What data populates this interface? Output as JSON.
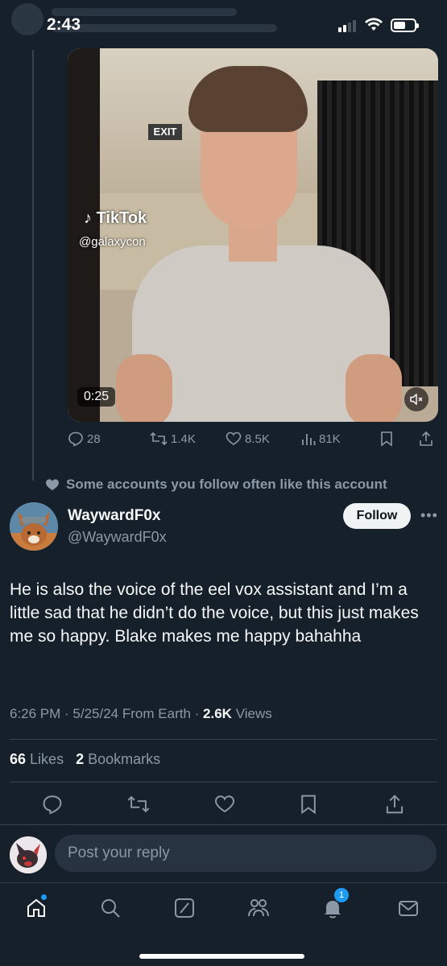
{
  "status_bar": {
    "time": "2:43"
  },
  "video": {
    "exit_sign": "EXIT",
    "tiktok_logo": "TikTok",
    "tiktok_handle": "@galaxycon",
    "duration": "0:25"
  },
  "quoted_stats": {
    "replies": "28",
    "reposts": "1.4K",
    "likes": "8.5K",
    "views": "81K"
  },
  "social_context": "Some accounts you follow often like this account",
  "author": {
    "display_name": "WaywardF0x",
    "handle": "@WaywardF0x",
    "follow_label": "Follow"
  },
  "tweet": {
    "text": "He is also the voice of the eel vox assistant and I’m a little sad that he didn’t do the voice, but this just makes me so happy. Blake makes me happy bahahha",
    "time": "6:26 PM",
    "date": "5/25/24",
    "source": "From Earth",
    "views_count": "2.6K",
    "views_label": "Views"
  },
  "engagement": {
    "likes_count": "66",
    "likes_label": "Likes",
    "bookmarks_count": "2",
    "bookmarks_label": "Bookmarks"
  },
  "reply": {
    "placeholder": "Post your reply"
  },
  "nav": {
    "notification_count": "1"
  },
  "colors": {
    "background": "#15202b",
    "accent": "#1d9bf0",
    "muted_text": "#8b98a5",
    "divider": "#38444d"
  }
}
